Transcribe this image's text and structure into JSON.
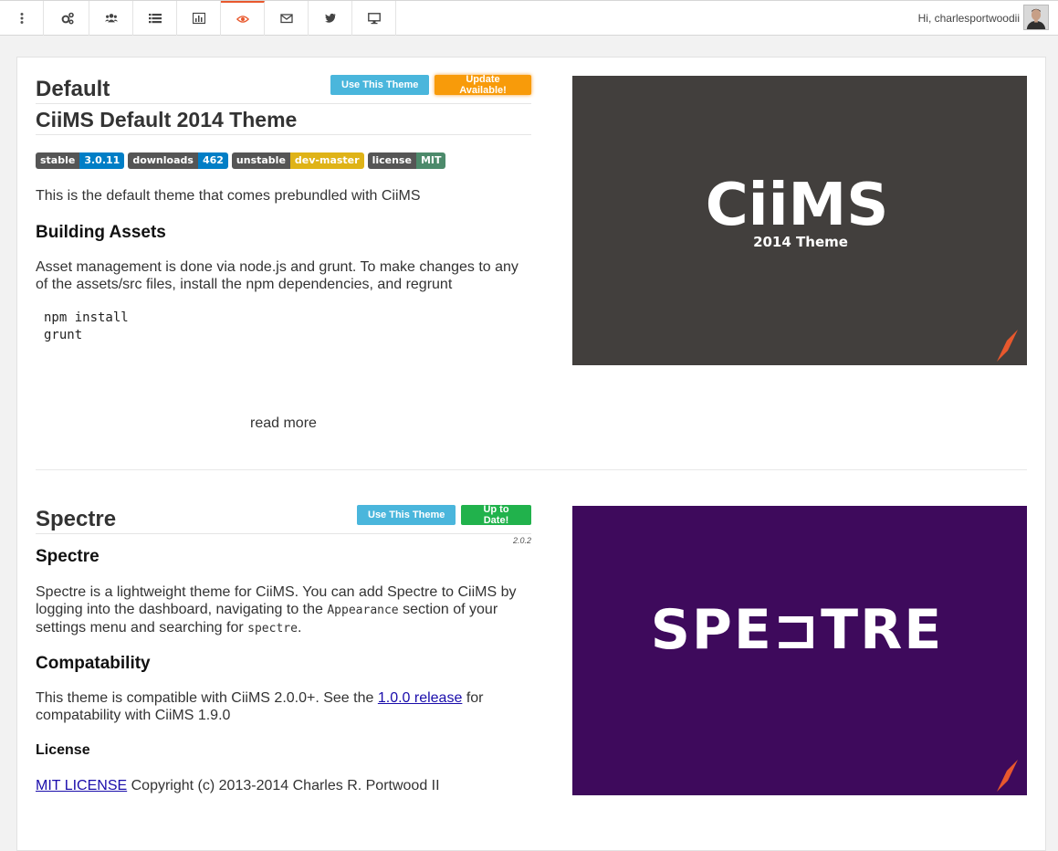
{
  "nav": {
    "items": [
      {
        "icon": "vertical-dots-icon",
        "active": false
      },
      {
        "icon": "cogs-icon",
        "active": false
      },
      {
        "icon": "users-icon",
        "active": false
      },
      {
        "icon": "list-icon",
        "active": false
      },
      {
        "icon": "bar-chart-icon",
        "active": false
      },
      {
        "icon": "eye-icon",
        "active": true
      },
      {
        "icon": "envelope-icon",
        "active": false
      },
      {
        "icon": "twitter-icon",
        "active": false
      },
      {
        "icon": "desktop-icon",
        "active": false
      }
    ],
    "greeting": "Hi, charlesportwoodii",
    "accent_color": "#e8582d"
  },
  "themes": [
    {
      "name": "Default",
      "use_button": "Use This Theme",
      "status_button": "Update Available!",
      "subtitle": "CiiMS Default 2014 Theme",
      "badges": [
        {
          "left": "stable",
          "right": "3.0.11",
          "color": "#007ec6"
        },
        {
          "left": "downloads",
          "right": "462",
          "color": "#007ec6"
        },
        {
          "left": "unstable",
          "right": "dev-master",
          "color": "#dfb317"
        },
        {
          "left": "license",
          "right": "MIT",
          "color": "#4c8a6b"
        }
      ],
      "description": "This is the default theme that comes prebundled with CiiMS",
      "section_heading": "Building Assets",
      "section_text": "Asset management is done via node.js and grunt. To make changes to any of the assets/src files, install the npm dependencies, and regrunt",
      "code_line_1": "npm install",
      "code_line_2": "grunt",
      "read_more": "read more",
      "preview": {
        "title": "CiiMS",
        "subtitle": "2014 Theme",
        "background": "#423f3d"
      }
    },
    {
      "name": "Spectre",
      "use_button": "Use This Theme",
      "status_button": "Up to Date!",
      "version": "2.0.2",
      "heading": "Spectre",
      "description_1": "Spectre is a lightweight theme for CiiMS. You can add Spectre to CiiMS by logging into the dashboard, navigating to the",
      "description_code_1": "Appearance",
      "description_2": "section of your settings menu and searching for",
      "description_code_2": "spectre",
      "description_3": ".",
      "compat_heading": "Compatability",
      "compat_text_1": "This theme is compatible with CiiMS 2.0.0+. See the",
      "compat_link": "1.0.0 release",
      "compat_text_2": "for compatability with CiiMS 1.9.0",
      "license_heading": "License",
      "license_link": "MIT LICENSE",
      "license_text": "Copyright (c) 2013-2014 Charles R. Portwood II",
      "preview": {
        "title": "SPE⊐TRE",
        "background": "#3e0a5c"
      }
    }
  ]
}
